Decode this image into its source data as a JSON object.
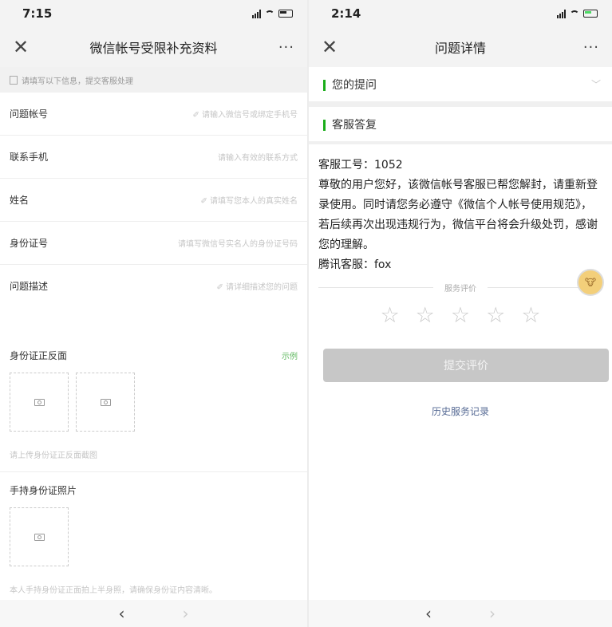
{
  "left": {
    "status": {
      "time": "7:15"
    },
    "nav": {
      "close": "✕",
      "title": "微信帐号受限补充资料",
      "more": "···"
    },
    "notice": "请填写以下信息，提交客服处理",
    "fields": [
      {
        "label": "问题帐号",
        "placeholder": "✐ 请输入微信号或绑定手机号"
      },
      {
        "label": "联系手机",
        "placeholder": "请输入有效的联系方式"
      },
      {
        "label": "姓名",
        "placeholder": "✐ 请填写您本人的真实姓名"
      },
      {
        "label": "身份证号",
        "placeholder": "请填写微信号实名人的身份证号码"
      },
      {
        "label": "问题描述",
        "placeholder": "✐ 请详细描述您的问题"
      }
    ],
    "id_section": {
      "title": "身份证正反面",
      "example": "示例",
      "hint": "请上传身份证正反面截图"
    },
    "hold_section": {
      "title": "手持身份证照片",
      "hint": "本人手持身份证正面拍上半身照，请确保身份证内容清晰。"
    },
    "toolbar": {
      "back": "‹",
      "forward": "›"
    }
  },
  "right": {
    "status": {
      "time": "2:14"
    },
    "nav": {
      "close": "✕",
      "title": "问题详情",
      "more": "···"
    },
    "question": {
      "label": "您的提问",
      "chevron": "﹀"
    },
    "reply": {
      "label": "客服答复",
      "lines": [
        "客服工号：1052",
        "尊敬的用户您好，该微信帐号客服已帮您解封，请重新登录使用。同时请您务必遵守《微信个人帐号使用规范》，若后续再次出现违规行为，微信平台将会升级处罚，感谢您的理解。",
        "腾讯客服：fox"
      ],
      "avatar": "🐮"
    },
    "rating": {
      "label": "服务评价",
      "stars": [
        "☆",
        "☆",
        "☆",
        "☆",
        "☆"
      ]
    },
    "submit": "提交评价",
    "history": "历史服务记录",
    "toolbar": {
      "back": "‹",
      "forward": "›"
    }
  }
}
